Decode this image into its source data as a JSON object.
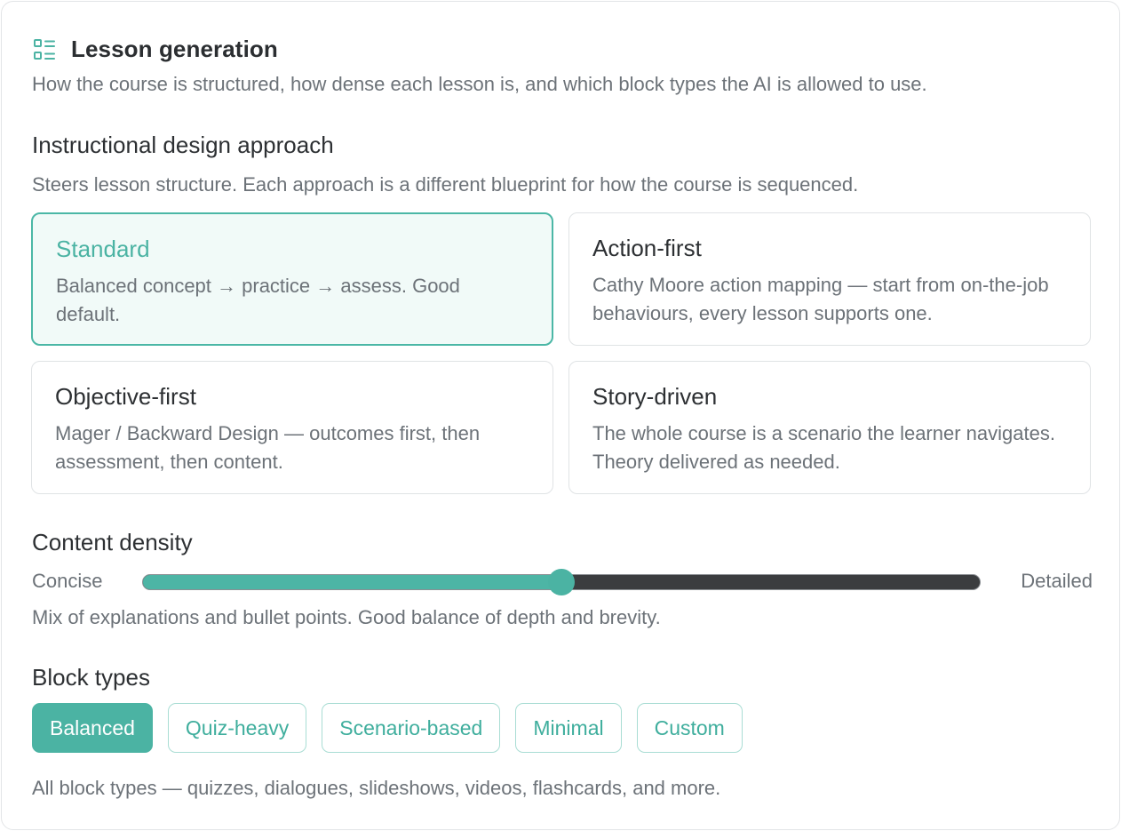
{
  "section": {
    "icon": "layout-list-icon",
    "title": "Lesson generation",
    "subtitle": "How the course is structured, how dense each lesson is, and which block types the AI is allowed to use."
  },
  "approach": {
    "heading": "Instructional design approach",
    "description": "Steers lesson structure. Each approach is a different blueprint for how the course is sequenced.",
    "selected": "Standard",
    "options": [
      {
        "title": "Standard",
        "description": "Balanced concept → practice → assess. Good default."
      },
      {
        "title": "Action-first",
        "description": "Cathy Moore action mapping — start from on-the-job behaviours, every lesson supports one."
      },
      {
        "title": "Objective-first",
        "description": "Mager / Backward Design — outcomes first, then assessment, then content."
      },
      {
        "title": "Story-driven",
        "description": "The whole course is a scenario the learner navigates. Theory delivered as needed."
      }
    ]
  },
  "density": {
    "heading": "Content density",
    "min_label": "Concise",
    "max_label": "Detailed",
    "value": 0.5,
    "description": "Mix of explanations and bullet points. Good balance of depth and brevity."
  },
  "block_types": {
    "heading": "Block types",
    "selected": "Balanced",
    "options": [
      "Balanced",
      "Quiz-heavy",
      "Scenario-based",
      "Minimal",
      "Custom"
    ],
    "description": "All block types — quizzes, dialogues, slideshows, videos, flashcards, and more."
  },
  "colors": {
    "accent": "#4bb3a3",
    "selected_bg": "#f1faf8",
    "text": "#2d3033",
    "muted": "#6c7278"
  }
}
